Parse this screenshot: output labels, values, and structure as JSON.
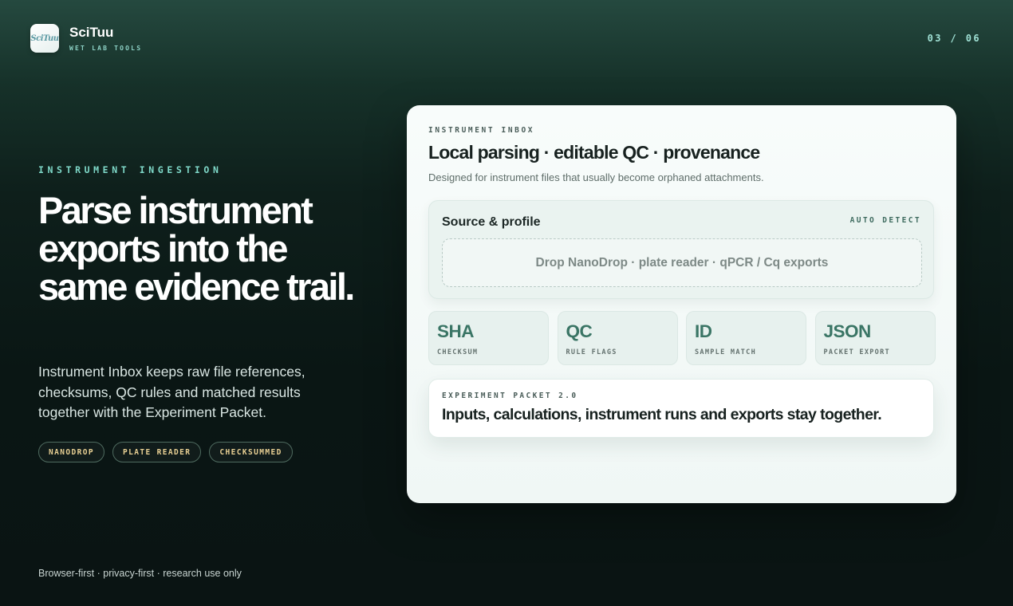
{
  "brand": {
    "logo_text": "SciTuu",
    "name": "SciTuu",
    "subtitle": "WET LAB TOOLS"
  },
  "slide_counter": "03 / 06",
  "hero": {
    "eyebrow": "INSTRUMENT INGESTION",
    "headline": "Parse instrument exports into the same evidence trail.",
    "lede": "Instrument Inbox keeps raw file references, checksums, QC rules and matched results together with the Experiment Packet.",
    "chips": [
      "NANODROP",
      "PLATE READER",
      "CHECKSUMMED"
    ]
  },
  "card": {
    "eyebrow": "INSTRUMENT INBOX",
    "title": "Local parsing · editable QC · provenance",
    "description": "Designed for instrument files that usually become orphaned attachments.",
    "source": {
      "title": "Source & profile",
      "action": "AUTO DETECT",
      "dropzone": "Drop NanoDrop · plate reader · qPCR / Cq exports"
    },
    "features": [
      {
        "big": "SHA",
        "small": "CHECKSUM"
      },
      {
        "big": "QC",
        "small": "RULE FLAGS"
      },
      {
        "big": "ID",
        "small": "SAMPLE MATCH"
      },
      {
        "big": "JSON",
        "small": "PACKET EXPORT"
      }
    ],
    "packet": {
      "eyebrow": "EXPERIMENT PACKET 2.0",
      "title": "Inputs, calculations, instrument runs and exports stay together."
    }
  },
  "footer": "Browser-first · privacy-first · research use only",
  "colors": {
    "accent_teal": "#7fd9c9",
    "chip_text": "#e8cf93",
    "feature_green": "#3a7565",
    "card_bg": "#f5faf8"
  }
}
